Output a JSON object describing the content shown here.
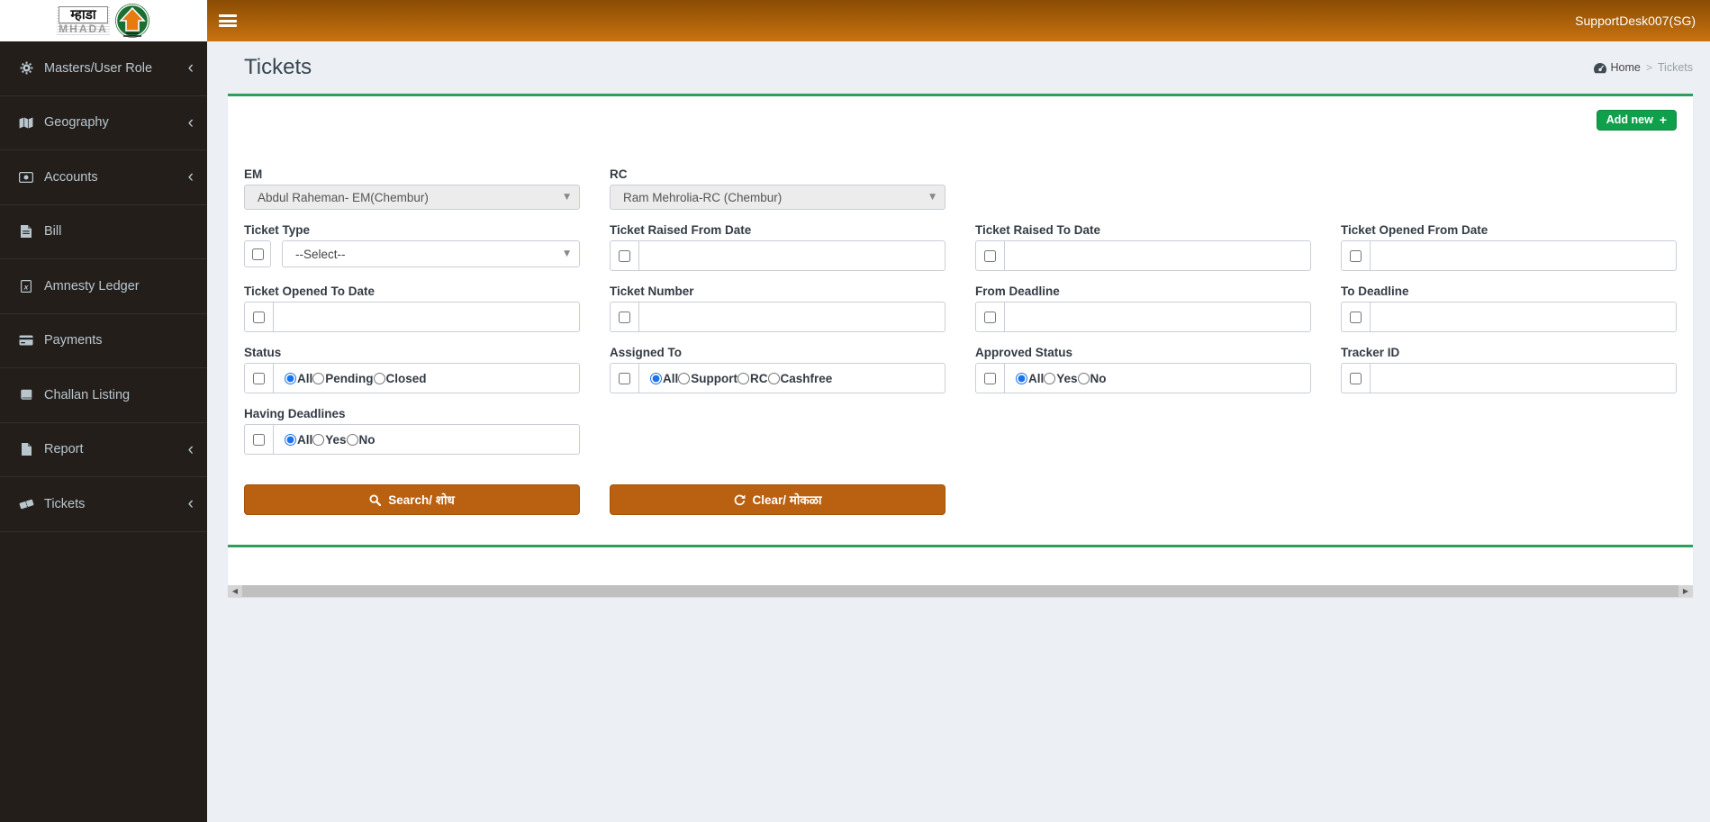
{
  "logo": {
    "devanagari": "म्हाडा",
    "latin": "MHADA"
  },
  "navbar": {
    "user_label": "SupportDesk007(SG)"
  },
  "sidebar": {
    "items": [
      {
        "label": "Masters/User Role",
        "icon": "cogs-icon",
        "has_submenu": true
      },
      {
        "label": "Geography",
        "icon": "map-icon",
        "has_submenu": true
      },
      {
        "label": "Accounts",
        "icon": "money-icon",
        "has_submenu": true
      },
      {
        "label": "Bill",
        "icon": "file-text-icon",
        "has_submenu": false
      },
      {
        "label": "Amnesty Ledger",
        "icon": "file-excel-icon",
        "has_submenu": false
      },
      {
        "label": "Payments",
        "icon": "credit-card-icon",
        "has_submenu": false
      },
      {
        "label": "Challan Listing",
        "icon": "book-icon",
        "has_submenu": false
      },
      {
        "label": "Report",
        "icon": "file-icon",
        "has_submenu": true
      },
      {
        "label": "Tickets",
        "icon": "ticket-icon",
        "has_submenu": true
      }
    ]
  },
  "page": {
    "title": "Tickets",
    "breadcrumb_home": "Home",
    "breadcrumb_separator": ">",
    "breadcrumb_current": "Tickets",
    "add_new_label": "Add new"
  },
  "filters": {
    "em": {
      "label": "EM",
      "value": "Abdul Raheman- EM(Chembur)",
      "disabled": true
    },
    "rc": {
      "label": "RC",
      "value": "Ram Mehrolia-RC (Chembur)",
      "disabled": true
    },
    "ticket_type": {
      "label": "Ticket Type",
      "value": "--Select--"
    },
    "raised_from": {
      "label": "Ticket Raised From Date",
      "value": ""
    },
    "raised_to": {
      "label": "Ticket Raised To Date",
      "value": ""
    },
    "opened_from": {
      "label": "Ticket Opened From Date",
      "value": ""
    },
    "opened_to": {
      "label": "Ticket Opened To Date",
      "value": ""
    },
    "ticket_number": {
      "label": "Ticket Number",
      "value": ""
    },
    "from_deadline": {
      "label": "From Deadline",
      "value": ""
    },
    "to_deadline": {
      "label": "To Deadline",
      "value": ""
    },
    "status": {
      "label": "Status",
      "options": [
        "All",
        "Pending",
        "Closed"
      ],
      "selected": "All"
    },
    "assigned_to": {
      "label": "Assigned To",
      "options": [
        "All",
        "Support",
        "RC",
        "Cashfree"
      ],
      "selected": "All"
    },
    "approved_status": {
      "label": "Approved Status",
      "options": [
        "All",
        "Yes",
        "No"
      ],
      "selected": "All"
    },
    "tracker_id": {
      "label": "Tracker ID",
      "value": ""
    },
    "having_deadlines": {
      "label": "Having Deadlines",
      "options": [
        "All",
        "Yes",
        "No"
      ],
      "selected": "All"
    }
  },
  "buttons": {
    "search": "Search/ शोध",
    "clear": "Clear/ मोकळा"
  },
  "colors": {
    "navbar_gradient_top": "#8a4c04",
    "navbar_gradient_bottom": "#c9720f",
    "sidebar_bg": "#241e1b",
    "sidebar_text": "#b8c7ce",
    "content_bg": "#ecf0f5",
    "panel_accent_green": "#2e9e5a",
    "add_button_green": "#10a04c",
    "action_button_orange": "#b96110",
    "radio_selected_blue": "#1a73e8",
    "logo_circle_green": "#1b6f33",
    "logo_house_orange": "#e87b10"
  }
}
